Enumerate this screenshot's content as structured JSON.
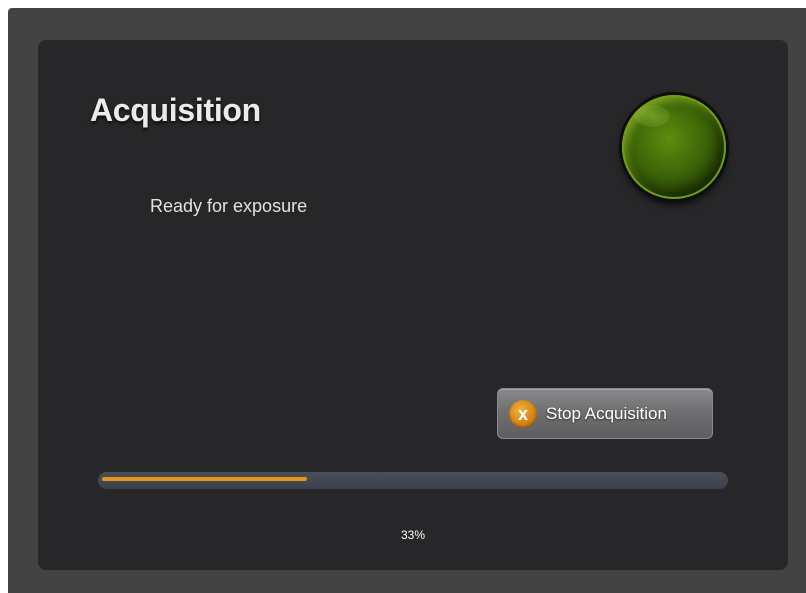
{
  "dialog": {
    "title": "Acquisition",
    "status_message": "Ready for exposure",
    "status_light": {
      "state": "green",
      "color": "#4f7d0b"
    },
    "stop_button": {
      "label": "Stop Acquisition",
      "icon": "x-circle-icon",
      "icon_glyph": "x",
      "icon_color": "#e08a1c"
    },
    "progress": {
      "value": 0.33,
      "label": "33%",
      "fill_color": "#e8931b",
      "track_color": "#434a53"
    }
  },
  "colors": {
    "window_background": "#434343",
    "panel_background": "#272729"
  }
}
